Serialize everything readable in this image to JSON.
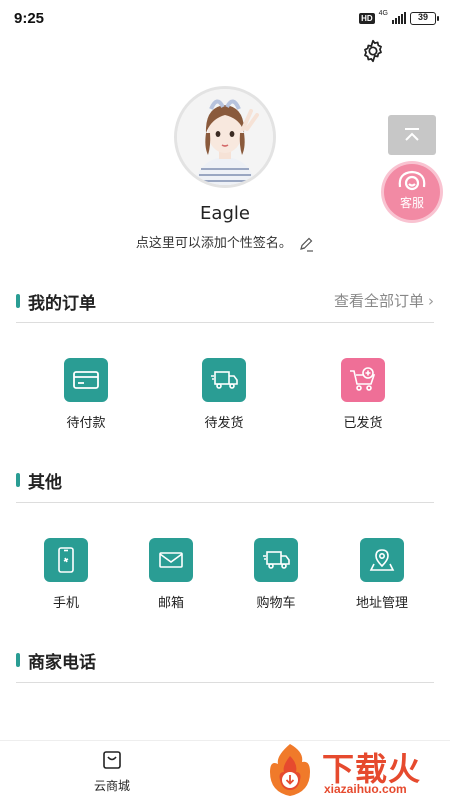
{
  "status_bar": {
    "time": "9:25",
    "hd": "HD",
    "network": "4G",
    "battery": "39",
    "battery_level_percent": 39
  },
  "profile": {
    "username": "Eagle",
    "signature_prompt": "点这里可以添加个性签名。"
  },
  "floating": {
    "customer_service_label": "客服"
  },
  "orders": {
    "title": "我的订单",
    "view_all": "查看全部订单",
    "items": [
      {
        "label": "待付款",
        "icon": "card-icon"
      },
      {
        "label": "待发货",
        "icon": "truck-icon"
      },
      {
        "label": "已发货",
        "icon": "cart-plus-icon"
      }
    ]
  },
  "other": {
    "title": "其他",
    "items": [
      {
        "label": "手机",
        "icon": "phone-icon"
      },
      {
        "label": "邮箱",
        "icon": "mail-icon"
      },
      {
        "label": "购物车",
        "icon": "truck-icon"
      },
      {
        "label": "地址管理",
        "icon": "map-pin-icon"
      }
    ]
  },
  "merchant": {
    "title": "商家电话"
  },
  "tabbar": {
    "home_label": "云商城"
  },
  "watermark": {
    "brand": "下载火",
    "site": "xiazaihuo.com"
  },
  "colors": {
    "accent": "#2a9d94",
    "pink": "#ef6f97",
    "service": "#f28aa4",
    "watermark": "#e64a2e"
  }
}
